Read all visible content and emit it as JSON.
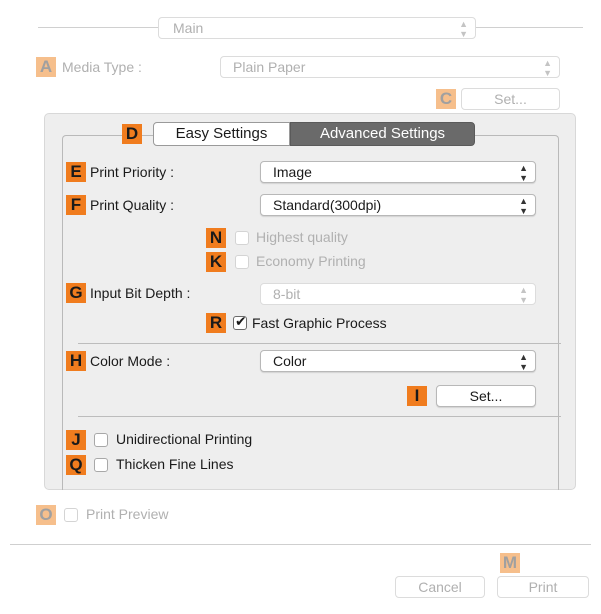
{
  "main_popup": {
    "value": "Main"
  },
  "media_type": {
    "badge": "A",
    "label": "Media Type :",
    "value": "Plain Paper"
  },
  "media_set": {
    "badge": "C",
    "label": "Set..."
  },
  "tabs": {
    "badge": "D",
    "easy": "Easy Settings",
    "advanced": "Advanced Settings",
    "selected": "advanced"
  },
  "print_priority": {
    "badge": "E",
    "label": "Print Priority :",
    "value": "Image"
  },
  "print_quality": {
    "badge": "F",
    "label": "Print Quality :",
    "value": "Standard(300dpi)"
  },
  "highest_quality": {
    "badge": "N",
    "label": "Highest quality",
    "checked": false
  },
  "economy_printing": {
    "badge": "K",
    "label": "Economy Printing",
    "checked": false
  },
  "input_bit_depth": {
    "badge": "G",
    "label": "Input Bit Depth :",
    "value": "8-bit"
  },
  "fast_graphic": {
    "badge": "R",
    "label": "Fast Graphic Process",
    "checked": true
  },
  "color_mode": {
    "badge": "H",
    "label": "Color Mode :",
    "value": "Color"
  },
  "color_set": {
    "badge": "I",
    "label": "Set..."
  },
  "unidirectional": {
    "badge": "J",
    "label": "Unidirectional Printing",
    "checked": false
  },
  "thicken_lines": {
    "badge": "Q",
    "label": "Thicken Fine Lines",
    "checked": false
  },
  "print_preview": {
    "badge": "O",
    "label": "Print Preview",
    "checked": false
  },
  "footer": {
    "badge": "M",
    "cancel": "Cancel",
    "print": "Print"
  },
  "icons": {
    "popup_arrows": "updown-arrows-icon",
    "checkmark": "checkmark-icon"
  },
  "colors": {
    "badge": "#f07c1e",
    "badge_dim": "#f6bf8c",
    "tab_selected": "#6a6a6a"
  }
}
